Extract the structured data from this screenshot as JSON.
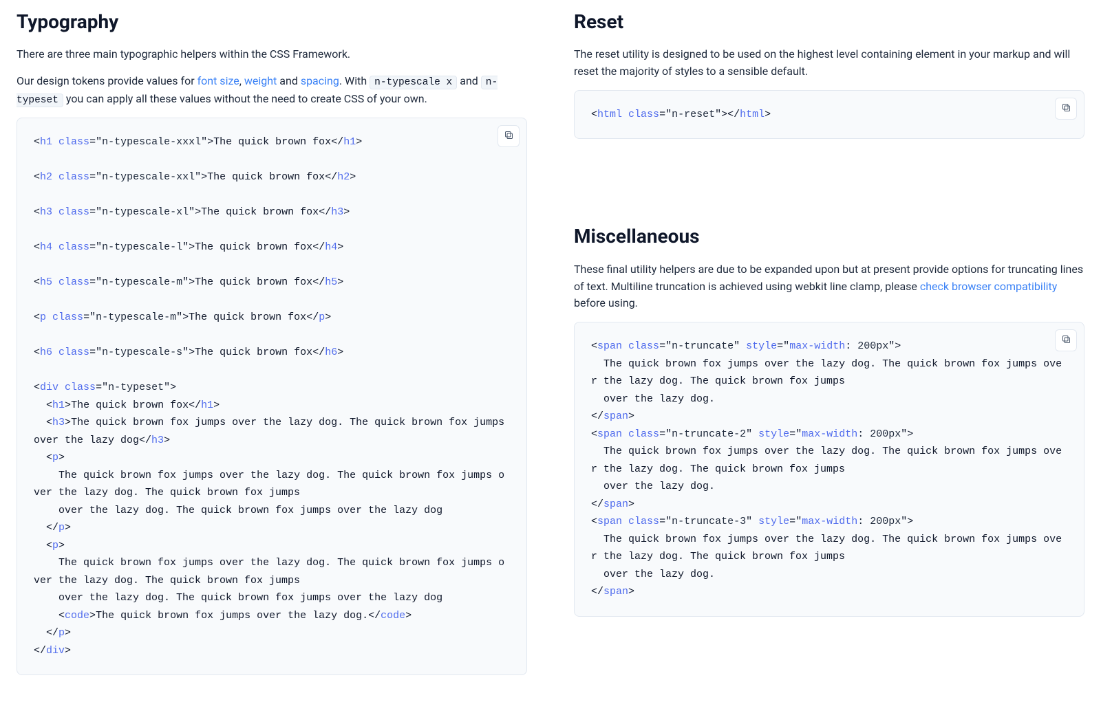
{
  "typography": {
    "heading": "Typography",
    "intro": "There are three main typographic helpers within the CSS Framework.",
    "p2_a": "Our design tokens provide values for ",
    "link_fontsize": "font size",
    "sep1": ", ",
    "link_weight": "weight",
    "sep2": " and ",
    "link_spacing": "spacing",
    "p2_b": ". With ",
    "code_typescale": "n-typescale x",
    "p2_c": " and ",
    "code_typeset": "n-typeset",
    "p2_d": " you can apply all these values without the need to create CSS of your own.",
    "code": {
      "lines": [
        {
          "kind": "el",
          "tag": "h1",
          "cls": "n-typescale-xxxl",
          "text": "The quick brown fox",
          "close": "h1"
        },
        {
          "kind": "blank"
        },
        {
          "kind": "el",
          "tag": "h2",
          "cls": "n-typescale-xxl",
          "text": "The quick brown fox",
          "close": "h2"
        },
        {
          "kind": "blank"
        },
        {
          "kind": "el",
          "tag": "h3",
          "cls": "n-typescale-xl",
          "text": "The quick brown fox",
          "close": "h3"
        },
        {
          "kind": "blank"
        },
        {
          "kind": "el",
          "tag": "h4",
          "cls": "n-typescale-l",
          "text": "The quick brown fox",
          "close": "h4"
        },
        {
          "kind": "blank"
        },
        {
          "kind": "el",
          "tag": "h5",
          "cls": "n-typescale-m",
          "text": "The quick brown fox",
          "close": "h5"
        },
        {
          "kind": "blank"
        },
        {
          "kind": "el",
          "tag": "p",
          "cls": "n-typescale-m",
          "text": "The quick brown fox",
          "close": "p"
        },
        {
          "kind": "blank"
        },
        {
          "kind": "el",
          "tag": "h6",
          "cls": "n-typescale-s",
          "text": "The quick brown fox",
          "close": "h6"
        },
        {
          "kind": "blank"
        },
        {
          "kind": "open",
          "tag": "div",
          "cls": "n-typeset"
        },
        {
          "kind": "simple",
          "indent": "  ",
          "tag": "h1",
          "text": "The quick brown fox",
          "close": "h1"
        },
        {
          "kind": "simple",
          "indent": "  ",
          "tag": "h3",
          "text": "The quick brown fox jumps over the lazy dog. The quick brown fox jumps over the lazy dog",
          "close": "h3"
        },
        {
          "kind": "openonly",
          "indent": "  ",
          "tag": "p"
        },
        {
          "kind": "text",
          "indent": "    ",
          "text": "The quick brown fox jumps over the lazy dog. The quick brown fox jumps over the lazy dog. The quick brown fox jumps"
        },
        {
          "kind": "text",
          "indent": "    ",
          "text": "over the lazy dog. The quick brown fox jumps over the lazy dog"
        },
        {
          "kind": "closeonly",
          "indent": "  ",
          "tag": "p"
        },
        {
          "kind": "openonly",
          "indent": "  ",
          "tag": "p"
        },
        {
          "kind": "text",
          "indent": "    ",
          "text": "The quick brown fox jumps over the lazy dog. The quick brown fox jumps over the lazy dog. The quick brown fox jumps"
        },
        {
          "kind": "text",
          "indent": "    ",
          "text": "over the lazy dog. The quick brown fox jumps over the lazy dog"
        },
        {
          "kind": "codeinline",
          "indent": "    ",
          "tag": "code",
          "text": "The quick brown fox jumps over the lazy dog.",
          "close": "code"
        },
        {
          "kind": "closeonly",
          "indent": "  ",
          "tag": "p"
        },
        {
          "kind": "closeonly",
          "indent": "",
          "tag": "div"
        }
      ]
    }
  },
  "reset": {
    "heading": "Reset",
    "intro": "The reset utility is designed to be used on the highest level containing element in your markup and will reset the majority of styles to a sensible default.",
    "code": {
      "tag": "html",
      "cls": "n-reset"
    }
  },
  "misc": {
    "heading": "Miscellaneous",
    "p_a": "These final utility helpers are due to be expanded upon but at present provide options for truncating lines of text. Multiline truncation is achieved using webkit line clamp, please ",
    "link": "check browser compatibility",
    "p_b": " before using.",
    "code": {
      "blocks": [
        {
          "tag": "span",
          "cls": "n-truncate",
          "style_prop": "max-width",
          "style_rest": ": 200px",
          "body": [
            "  The quick brown fox jumps over the lazy dog. The quick brown fox jumps over the lazy dog. The quick brown fox jumps",
            "  over the lazy dog."
          ]
        },
        {
          "tag": "span",
          "cls": "n-truncate-2",
          "style_prop": "max-width",
          "style_rest": ": 200px",
          "body": [
            "  The quick brown fox jumps over the lazy dog. The quick brown fox jumps over the lazy dog. The quick brown fox jumps",
            "  over the lazy dog."
          ]
        },
        {
          "tag": "span",
          "cls": "n-truncate-3",
          "style_prop": "max-width",
          "style_rest": ": 200px",
          "body": [
            "  The quick brown fox jumps over the lazy dog. The quick brown fox jumps over the lazy dog. The quick brown fox jumps",
            "  over the lazy dog."
          ]
        }
      ]
    }
  }
}
